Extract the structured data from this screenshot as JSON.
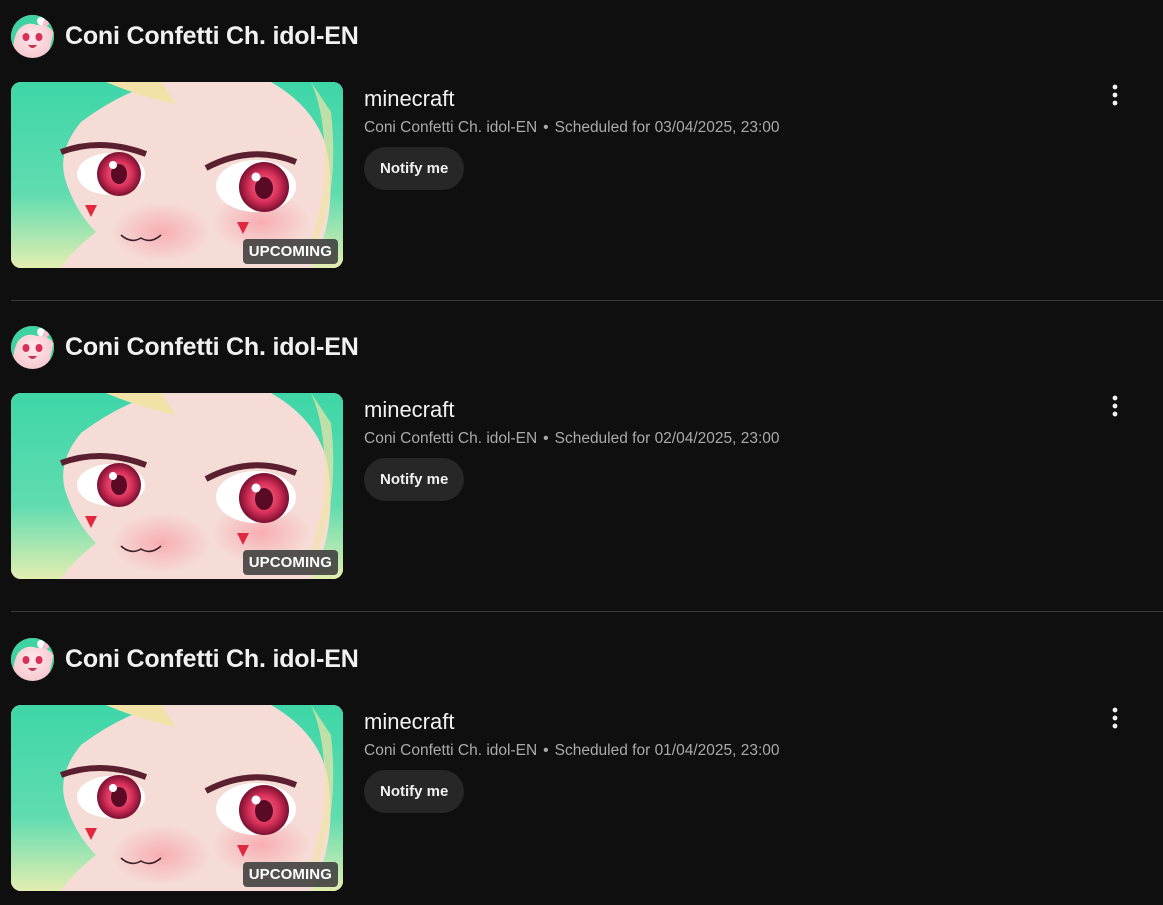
{
  "items": [
    {
      "channel_name": "Coni Confetti Ch. idol-EN",
      "video_title": "minecraft",
      "meta_channel": "Coni Confetti Ch. idol-EN",
      "meta_separator": "•",
      "scheduled_text": "Scheduled for 03/04/2025, 23:00",
      "badge": "UPCOMING",
      "notify_label": "Notify me"
    },
    {
      "channel_name": "Coni Confetti Ch. idol-EN",
      "video_title": "minecraft",
      "meta_channel": "Coni Confetti Ch. idol-EN",
      "meta_separator": "•",
      "scheduled_text": "Scheduled for 02/04/2025, 23:00",
      "badge": "UPCOMING",
      "notify_label": "Notify me"
    },
    {
      "channel_name": "Coni Confetti Ch. idol-EN",
      "video_title": "minecraft",
      "meta_channel": "Coni Confetti Ch. idol-EN",
      "meta_separator": "•",
      "scheduled_text": "Scheduled for 01/04/2025, 23:00",
      "badge": "UPCOMING",
      "notify_label": "Notify me"
    }
  ],
  "icons": {
    "menu": "more-vert-icon",
    "avatar": "channel-avatar",
    "thumbnail": "video-thumbnail"
  },
  "colors": {
    "background": "#0f0f0f",
    "text_primary": "#f1f1f1",
    "text_secondary": "#aaaaaa",
    "button_bg": "#272727",
    "divider": "#3a3a3a"
  }
}
